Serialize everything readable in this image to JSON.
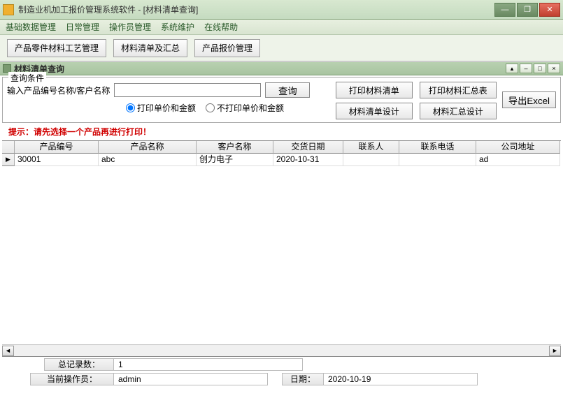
{
  "window": {
    "title": "制造业机加工报价管理系统软件  -  [材料清单查询]"
  },
  "menu": {
    "items": [
      "基础数据管理",
      "日常管理",
      "操作员管理",
      "系统维护",
      "在线帮助"
    ]
  },
  "toolbar": {
    "btn_process": "产品零件材料工艺管理",
    "btn_bom": "材料清单及汇总",
    "btn_quote": "产品报价管理"
  },
  "child": {
    "title": "材料清单查询"
  },
  "query": {
    "legend": "查询条件",
    "input_label": "输入产品编号名称/客户名称",
    "input_value": "",
    "btn_query": "查询",
    "radio_print": "打印单价和金额",
    "radio_noprint": "不打印单价和金额",
    "radio_selected": "print",
    "btn_print_list": "打印材料清单",
    "btn_print_summary": "打印材料汇总表",
    "btn_design_list": "材料清单设计",
    "btn_design_summary": "材料汇总设计",
    "btn_export": "导出Excel"
  },
  "hint": "提示：请先选择一个产品再进行打印！",
  "grid": {
    "columns": [
      "产品编号",
      "产品名称",
      "客户名称",
      "交货日期",
      "联系人",
      "联系电话",
      "公司地址"
    ],
    "rows": [
      {
        "product_no": "30001",
        "product_name": "abc",
        "customer": "创力电子",
        "delivery_date": "2020-10-31",
        "contact": "",
        "phone": "",
        "address": "ad"
      }
    ]
  },
  "status": {
    "total_label": "总记录数：",
    "total_value": "1",
    "operator_label": "当前操作员：",
    "operator_value": "admin",
    "date_label": "日期：",
    "date_value": "2020-10-19"
  }
}
